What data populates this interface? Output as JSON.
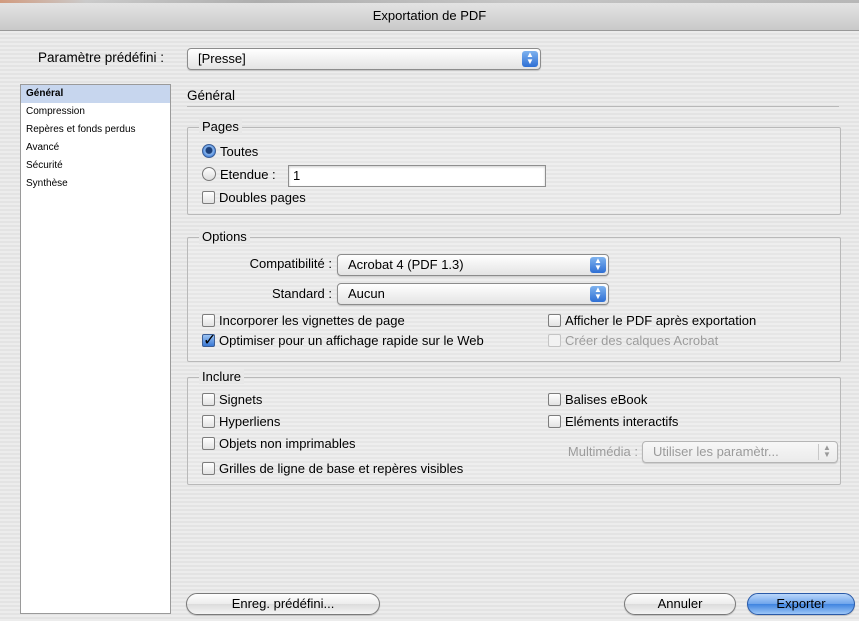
{
  "window": {
    "title": "Exportation de PDF"
  },
  "preset": {
    "label": "Paramètre prédéfini :",
    "value": "[Presse]"
  },
  "sidebar": {
    "items": [
      {
        "label": "Général",
        "selected": true
      },
      {
        "label": "Compression"
      },
      {
        "label": "Repères et fonds perdus"
      },
      {
        "label": "Avancé"
      },
      {
        "label": "Sécurité"
      },
      {
        "label": "Synthèse"
      }
    ]
  },
  "main": {
    "heading": "Général"
  },
  "pages": {
    "title": "Pages",
    "all_label": "Toutes",
    "all_selected": true,
    "range_label": "Etendue :",
    "range_value": "1",
    "spreads_label": "Doubles pages",
    "spreads_checked": false
  },
  "options": {
    "title": "Options",
    "compat_label": "Compatibilité :",
    "compat_value": "Acrobat 4 (PDF 1.3)",
    "standard_label": "Standard :",
    "standard_value": "Aucun",
    "thumbnails_label": "Incorporer les vignettes de page",
    "thumbnails_checked": false,
    "optimize_label": "Optimiser pour un affichage rapide sur le Web",
    "optimize_checked": true,
    "view_after_label": "Afficher le PDF après exportation",
    "view_after_checked": false,
    "layers_label": "Créer des calques Acrobat",
    "layers_enabled": false
  },
  "include": {
    "title": "Inclure",
    "bookmarks_label": "Signets",
    "hyperlinks_label": "Hyperliens",
    "nonprinting_label": "Objets non imprimables",
    "grids_label": "Grilles de ligne de base et repères visibles",
    "ebook_label": "Balises eBook",
    "interactive_label": "Eléments interactifs",
    "multimedia_label": "Multimédia :",
    "multimedia_value": "Utiliser les paramètr..."
  },
  "buttons": {
    "save_preset": "Enreg. prédéfini...",
    "cancel": "Annuler",
    "export": "Exporter"
  },
  "colors": {
    "accent": "#3f84e0",
    "selection": "#c7d6ee"
  }
}
